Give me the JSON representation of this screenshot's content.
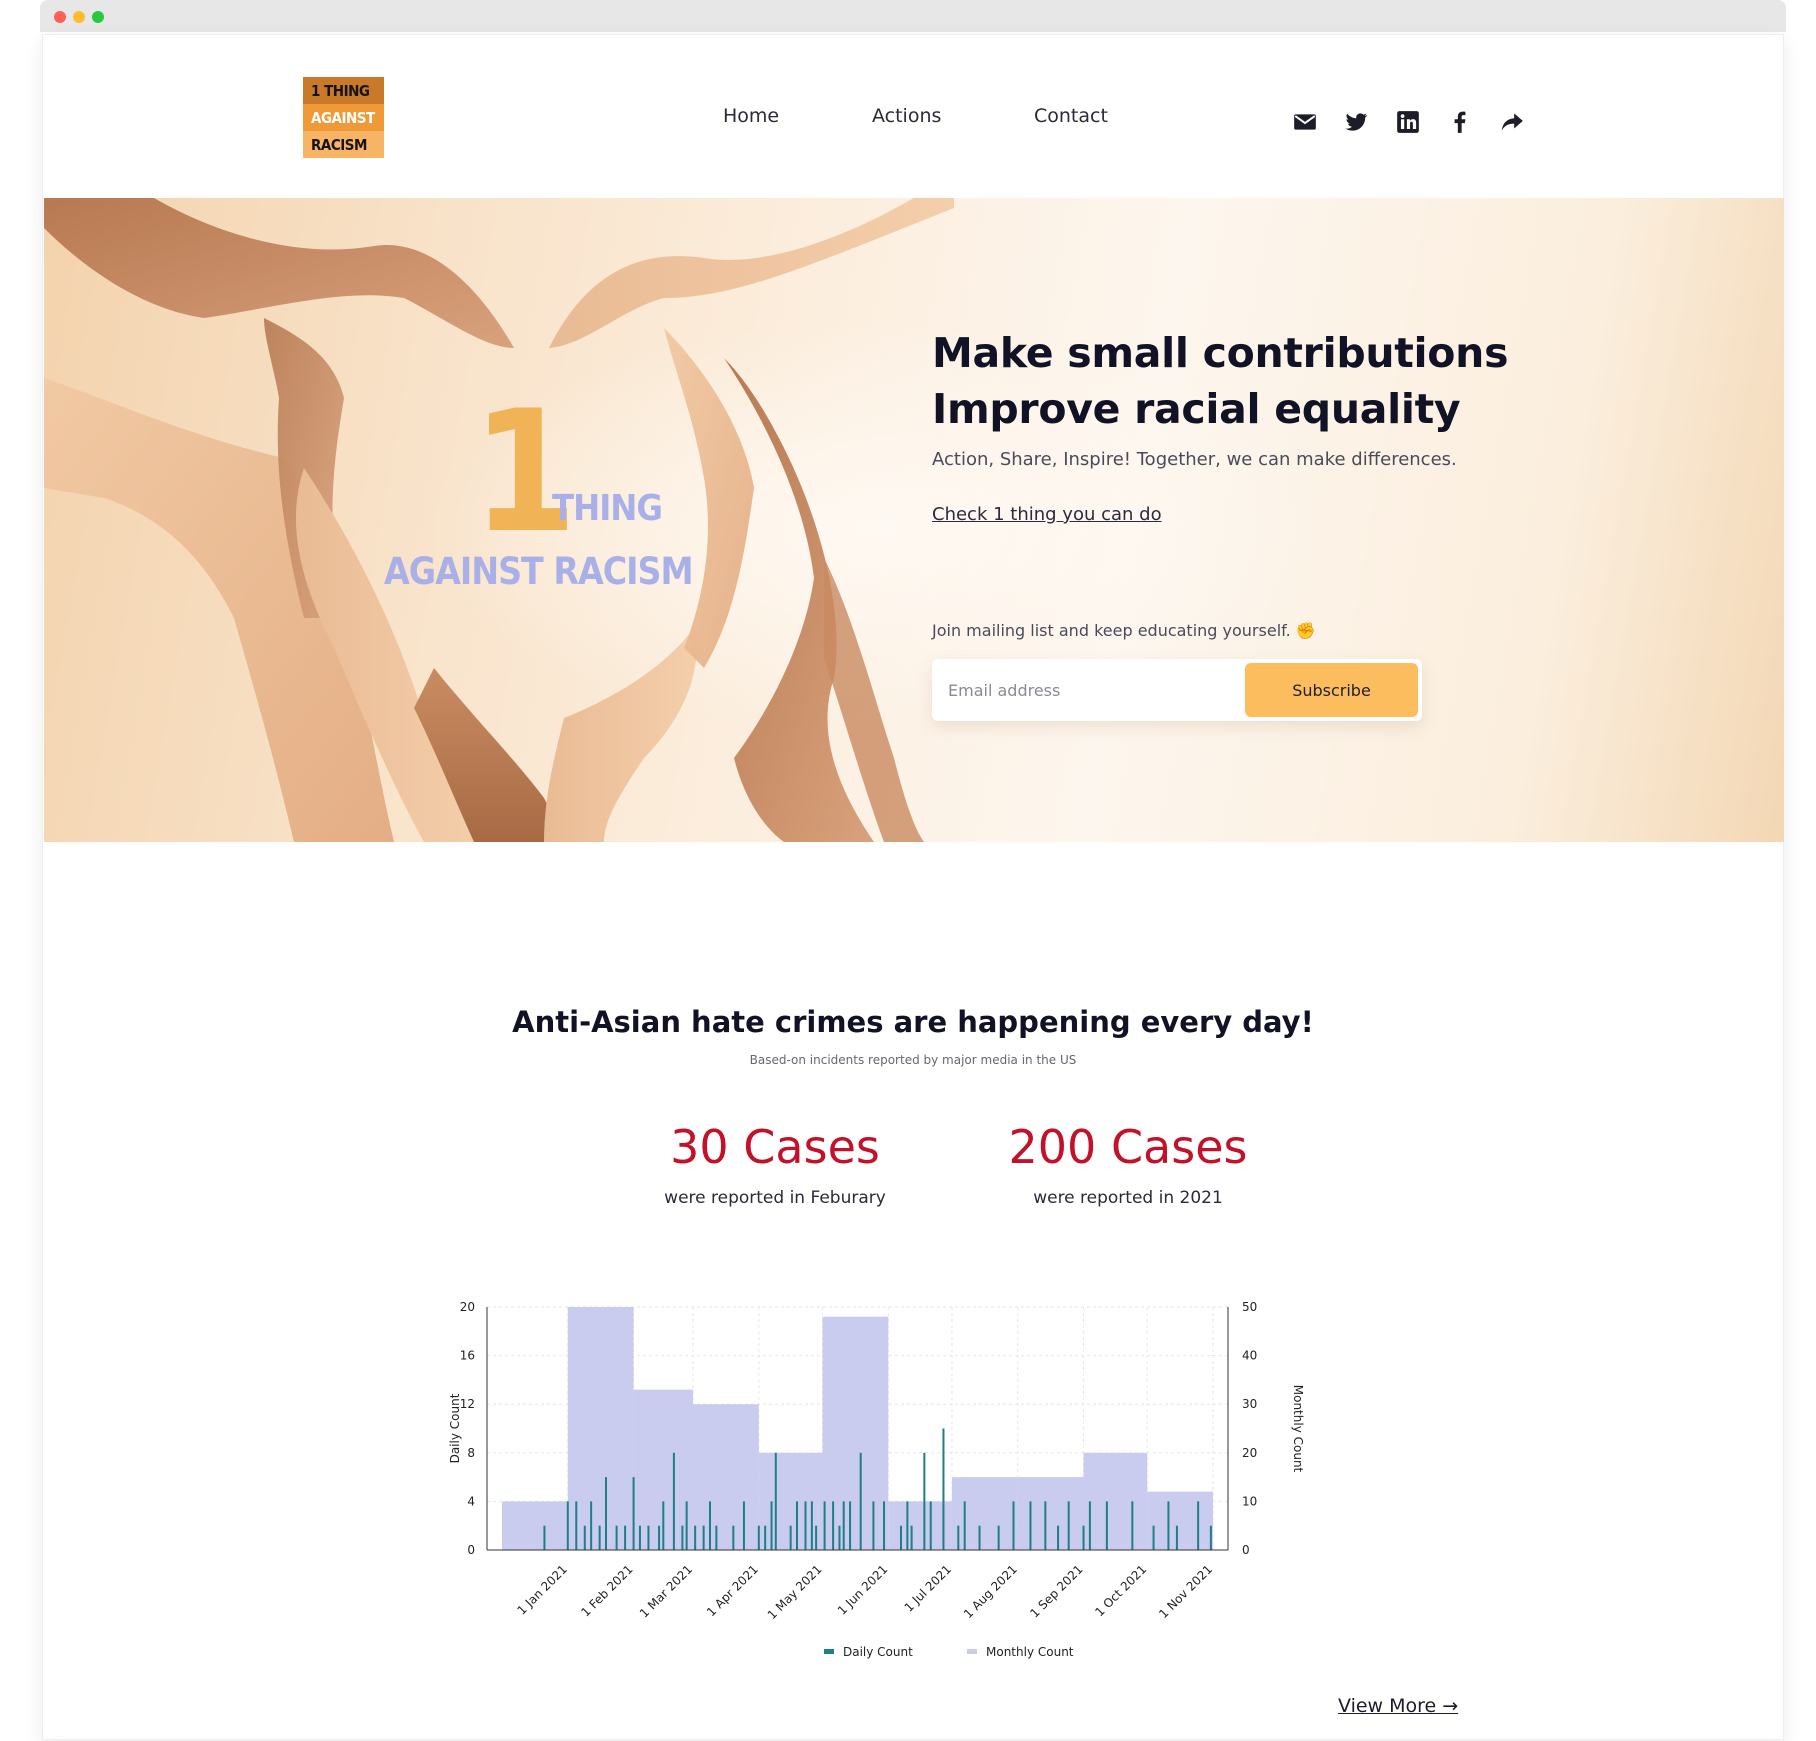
{
  "logo": {
    "line1": "1 THING",
    "line2": "AGAINST",
    "line3": "RACISM"
  },
  "nav": {
    "home": "Home",
    "actions": "Actions",
    "contact": "Contact"
  },
  "social": [
    "mail-icon",
    "twitter-icon",
    "linkedin-icon",
    "facebook-icon",
    "share-icon"
  ],
  "hero": {
    "logo_number": "1",
    "logo_thing": "THING",
    "logo_against": "AGAINST RACISM",
    "title_line1": "Make small contributions",
    "title_line2": "Improve racial equality",
    "subtitle": "Action, Share, Inspire! Together, we can make differences.",
    "link": "Check 1 thing you can do",
    "join_text": "Join mailing list and keep educating yourself. ✊",
    "email_placeholder": "Email address",
    "subscribe_label": "Subscribe"
  },
  "stats": {
    "title": "Anti-Asian hate crimes are happening every day!",
    "subtitle": "Based-on incidents reported by major media in the US",
    "stat1_number": "30 Cases",
    "stat1_label": "were reported in Feburary",
    "stat2_number": "200 Cases",
    "stat2_label": "were reported in 2021"
  },
  "chart_data": {
    "type": "bar",
    "y_left_label": "Daily Count",
    "y_right_label": "Monthly Count",
    "y_left_range": [
      0,
      20
    ],
    "y_left_ticks": [
      0,
      4,
      8,
      12,
      16,
      20
    ],
    "y_right_range": [
      0,
      50
    ],
    "y_right_ticks": [
      0,
      10,
      20,
      30,
      40,
      50
    ],
    "x_ticks": [
      "1 Jan 2021",
      "1 Feb 2021",
      "1 Mar 2021",
      "1 Apr 2021",
      "1 May 2021",
      "1 Jun 2021",
      "1 Jul 2021",
      "1 Aug 2021",
      "1 Sep 2021",
      "1 Oct 2021",
      "1 Nov 2021"
    ],
    "grid": true,
    "legend_position": "bottom",
    "series": [
      {
        "name": "Monthly Count",
        "color": "#c9ccee",
        "months": [
          "2020-12",
          "2021-01",
          "2021-02",
          "2021-03",
          "2021-04",
          "2021-05",
          "2021-06",
          "2021-07",
          "2021-08",
          "2021-09",
          "2021-10"
        ],
        "values": [
          10,
          50,
          33,
          30,
          20,
          48,
          10,
          15,
          15,
          20,
          12
        ]
      },
      {
        "name": "Daily Count",
        "color": "#1f7e88",
        "dates": [
          "2020-12-21",
          "2021-01-01",
          "2021-01-05",
          "2021-01-09",
          "2021-01-12",
          "2021-01-16",
          "2021-01-19",
          "2021-01-24",
          "2021-01-28",
          "2021-02-01",
          "2021-02-04",
          "2021-02-08",
          "2021-02-13",
          "2021-02-15",
          "2021-02-20",
          "2021-02-24",
          "2021-02-26",
          "2021-03-02",
          "2021-03-06",
          "2021-03-09",
          "2021-03-12",
          "2021-03-20",
          "2021-03-25",
          "2021-04-01",
          "2021-04-04",
          "2021-04-07",
          "2021-04-09",
          "2021-04-16",
          "2021-04-19",
          "2021-04-23",
          "2021-04-26",
          "2021-04-28",
          "2021-05-02",
          "2021-05-06",
          "2021-05-09",
          "2021-05-11",
          "2021-05-14",
          "2021-05-19",
          "2021-05-25",
          "2021-05-30",
          "2021-06-07",
          "2021-06-10",
          "2021-06-12",
          "2021-06-18",
          "2021-06-21",
          "2021-06-27",
          "2021-07-04",
          "2021-07-07",
          "2021-07-14",
          "2021-07-23",
          "2021-07-30",
          "2021-08-07",
          "2021-08-14",
          "2021-08-20",
          "2021-08-25",
          "2021-09-01",
          "2021-09-04",
          "2021-09-12",
          "2021-09-24",
          "2021-10-04",
          "2021-10-11",
          "2021-10-15",
          "2021-10-25",
          "2021-10-31"
        ],
        "values": [
          2,
          4,
          4,
          2,
          4,
          2,
          6,
          2,
          2,
          6,
          2,
          2,
          2,
          4,
          8,
          2,
          4,
          2,
          2,
          4,
          2,
          2,
          4,
          2,
          2,
          4,
          8,
          2,
          4,
          4,
          4,
          2,
          4,
          4,
          2,
          4,
          4,
          8,
          4,
          4,
          2,
          4,
          2,
          8,
          4,
          10,
          2,
          4,
          2,
          2,
          4,
          4,
          4,
          2,
          4,
          2,
          4,
          4,
          4,
          2,
          4,
          2,
          4,
          2
        ]
      }
    ]
  },
  "view_more": "View More →"
}
